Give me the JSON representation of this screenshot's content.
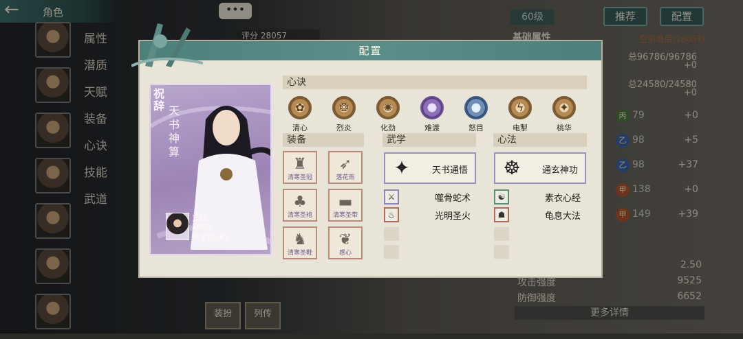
{
  "header": {
    "title": "角色",
    "back_icon": "arrow-left-icon",
    "chat_icon": "more-dots-icon",
    "chat_text": "•••"
  },
  "side_tabs": [
    "属性",
    "潜质",
    "天赋",
    "装备",
    "心诀",
    "技能",
    "武道"
  ],
  "top_right": {
    "level": "60级",
    "recommend_label": "推荐",
    "config_label": "配置"
  },
  "score": {
    "label": "评分",
    "value": "28057"
  },
  "right_panel": {
    "heading": "基础属性",
    "rank_text": "空前绝后(28057)",
    "hp": "总96786/96786",
    "hp_plus": "+0",
    "mp": "总24580/24580",
    "mp_plus": "+0",
    "stats": [
      {
        "icon": "丙",
        "value": "79",
        "plus": "+0",
        "color": "#4b7a3e"
      },
      {
        "icon": "乙",
        "value": "98",
        "plus": "+5",
        "color": "#3d63a3"
      },
      {
        "icon": "乙",
        "value": "98",
        "plus": "+37",
        "color": "#3d63a3"
      },
      {
        "icon": "甲",
        "value": "138",
        "plus": "+0",
        "color": "#b0542d"
      },
      {
        "icon": "甲",
        "value": "149",
        "plus": "+39",
        "color": "#b0542d"
      }
    ]
  },
  "bottom_stats": [
    {
      "label": "",
      "value": "2.50"
    },
    {
      "label": "攻击强度",
      "value": "9525"
    },
    {
      "label": "防御强度",
      "value": "6652"
    }
  ],
  "more_label": "更多详情",
  "bottom_tabs": [
    {
      "label": "装扮"
    },
    {
      "label": "列传"
    }
  ],
  "modal": {
    "title": "配置",
    "card": {
      "tag": "祝辞",
      "name": "天书神算",
      "owner_name": "五味",
      "owner_score": "2600",
      "owner_sect": "帝王宫(天)"
    },
    "xinjue": {
      "title": "心诀",
      "items": [
        {
          "label": "清心",
          "icon": "lotus-icon",
          "glyph": "✿",
          "style": ""
        },
        {
          "label": "烈炎",
          "icon": "flame-icon",
          "glyph": "❂",
          "style": ""
        },
        {
          "label": "化劲",
          "icon": "swirl-icon",
          "glyph": "✺",
          "style": ""
        },
        {
          "label": "难渡",
          "icon": "demon-icon",
          "glyph": "✵",
          "style": "purple"
        },
        {
          "label": "怒目",
          "icon": "eye-icon",
          "glyph": "◉",
          "style": "blue"
        },
        {
          "label": "电掣",
          "icon": "lightning-icon",
          "glyph": "ϟ",
          "style": ""
        },
        {
          "label": "桃华",
          "icon": "figure-icon",
          "glyph": "✦",
          "style": ""
        }
      ]
    },
    "equipment": {
      "title": "装备",
      "items": [
        {
          "label": "清寒圣冠",
          "icon": "crown-icon",
          "glyph": "♜"
        },
        {
          "label": "落花雨",
          "icon": "scroll-weapon-icon",
          "glyph": "➶"
        },
        {
          "label": "清寒圣袍",
          "icon": "robe-icon",
          "glyph": "♣"
        },
        {
          "label": "清寒圣带",
          "icon": "belt-icon",
          "glyph": "▬"
        },
        {
          "label": "清寒圣鞋",
          "icon": "boots-icon",
          "glyph": "♞"
        },
        {
          "label": "感心",
          "icon": "herb-icon",
          "glyph": "❦"
        }
      ]
    },
    "wuxue": {
      "title": "武学",
      "main": {
        "label": "天书通悟",
        "icon": "martial-pose-icon",
        "glyph": "🯅"
      },
      "subs": [
        {
          "label": "噬骨蛇术",
          "icon": "snake-strike-icon",
          "glyph": "⚔",
          "border": ""
        },
        {
          "label": "光明圣火",
          "icon": "holy-fire-icon",
          "glyph": "♨",
          "border": "red"
        }
      ]
    },
    "xinfa": {
      "title": "心法",
      "main": {
        "label": "通玄神功",
        "icon": "meditation-icon",
        "glyph": "☸"
      },
      "subs": [
        {
          "label": "素衣心经",
          "icon": "plain-robe-icon",
          "glyph": "☯",
          "border": "green"
        },
        {
          "label": "龟息大法",
          "icon": "turtle-breath-icon",
          "glyph": "☗",
          "border": "red"
        }
      ]
    }
  }
}
